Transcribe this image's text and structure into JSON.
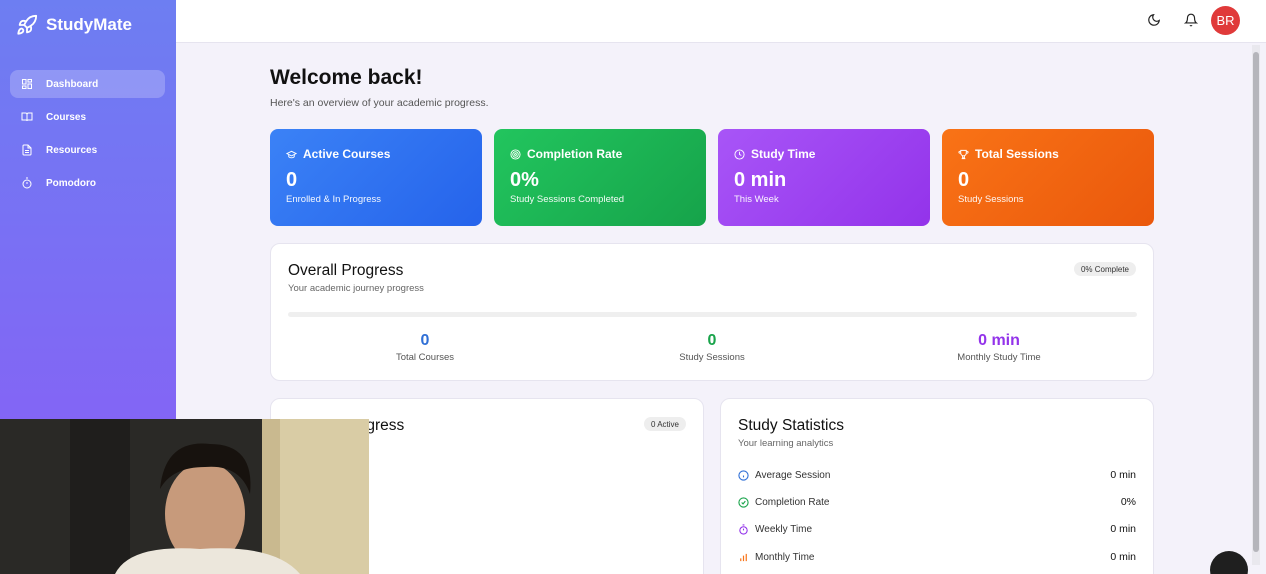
{
  "app": {
    "name": "StudyMate"
  },
  "sidebar": {
    "items": [
      {
        "label": "Dashboard",
        "icon": "dashboard-icon",
        "active": true
      },
      {
        "label": "Courses",
        "icon": "book-icon",
        "active": false
      },
      {
        "label": "Resources",
        "icon": "file-icon",
        "active": false
      },
      {
        "label": "Pomodoro",
        "icon": "timer-icon",
        "active": false
      }
    ]
  },
  "header": {
    "avatar_initials": "BR"
  },
  "main": {
    "title": "Welcome back!",
    "subtitle": "Here's an overview of your academic progress.",
    "cards": [
      {
        "title": "Active Courses",
        "value": "0",
        "caption": "Enrolled & In Progress",
        "icon": "graduation-cap-icon",
        "color": "#2f74f0"
      },
      {
        "title": "Completion Rate",
        "value": "0%",
        "caption": "Study Sessions Completed",
        "icon": "target-icon",
        "color": "#1eb04f"
      },
      {
        "title": "Study Time",
        "value": "0 min",
        "caption": "This Week",
        "icon": "clock-icon",
        "color": "#9c44ee"
      },
      {
        "title": "Total Sessions",
        "value": "0",
        "caption": "Study Sessions",
        "icon": "trophy-icon",
        "color": "#f1661a"
      }
    ],
    "overall": {
      "title": "Overall Progress",
      "subtitle": "Your academic journey progress",
      "badge": "0% Complete",
      "progress": 0,
      "metrics": [
        {
          "value": "0",
          "label": "Total Courses",
          "color": "#2f6fd6"
        },
        {
          "value": "0",
          "label": "Study Sessions",
          "color": "#18a34a"
        },
        {
          "value": "0 min",
          "label": "Monthly Study Time",
          "color": "#9333ea"
        }
      ]
    },
    "course_progress": {
      "title": "Course Progress",
      "badge": "0 Active"
    },
    "study_stats": {
      "title": "Study Statistics",
      "subtitle": "Your learning analytics",
      "rows": [
        {
          "label": "Average Session",
          "value": "0 min",
          "icon": "info-icon",
          "color": "#2f6fd6"
        },
        {
          "label": "Completion Rate",
          "value": "0%",
          "icon": "check-circle-icon",
          "color": "#18a34a"
        },
        {
          "label": "Weekly Time",
          "value": "0 min",
          "icon": "timer-icon",
          "color": "#9333ea"
        },
        {
          "label": "Monthly Time",
          "value": "0 min",
          "icon": "bar-chart-icon",
          "color": "#f97316"
        }
      ]
    }
  }
}
